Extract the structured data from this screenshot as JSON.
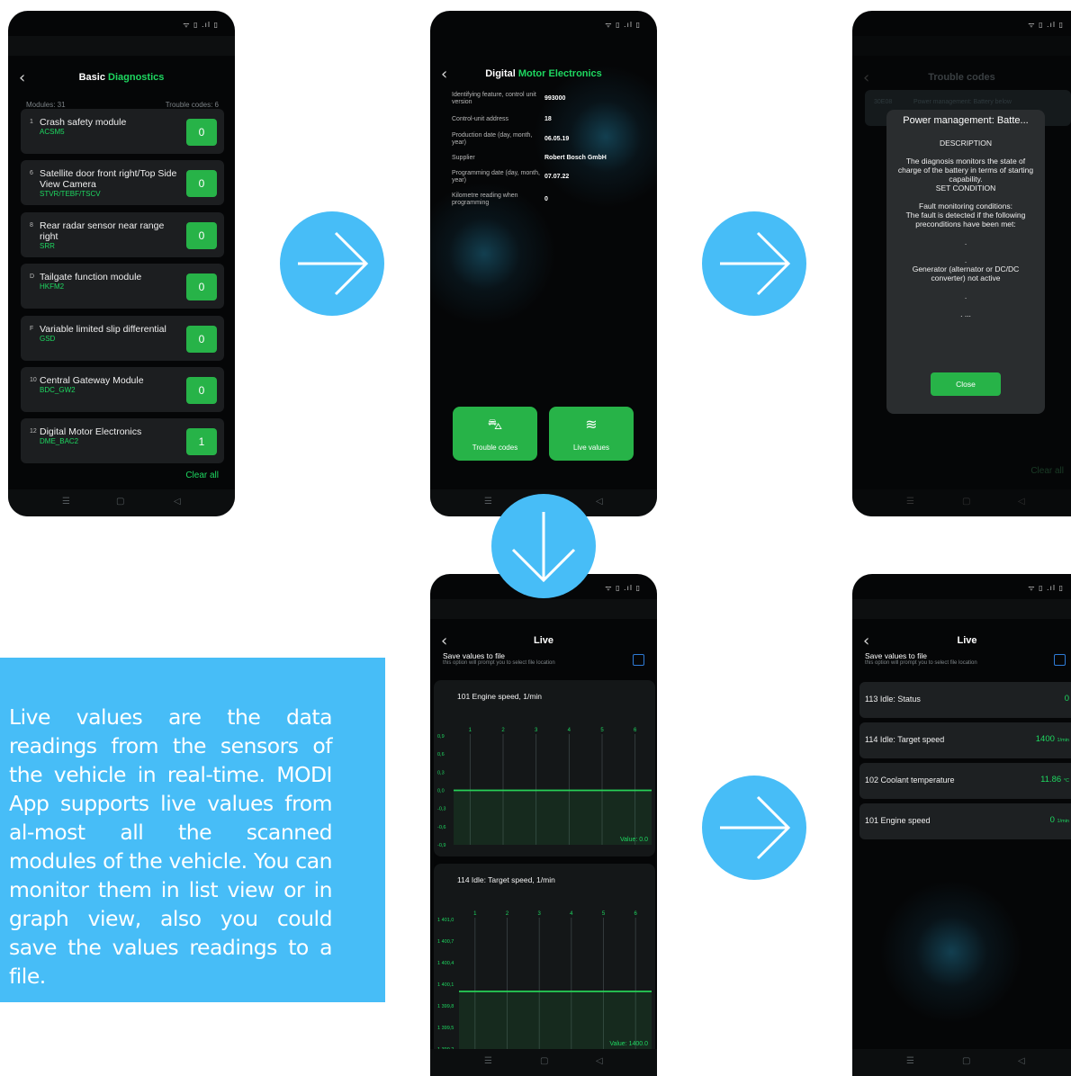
{
  "status_icons": "ᯤ ▯ .ıl ▯",
  "nav": {
    "menu": "☰",
    "home": "▢",
    "back": "◁"
  },
  "screen1": {
    "title_a": "Basic",
    "title_b": "Diagnostics",
    "modules_label": "Modules: 31",
    "trouble_label": "Trouble codes: 6",
    "modules": [
      {
        "num": "1",
        "name": "Crash safety module",
        "code": "ACSM5",
        "count": "0"
      },
      {
        "num": "6",
        "name": "Satellite door front right/Top Side View Camera",
        "code": "STVR/TEBF/TSCV",
        "count": "0"
      },
      {
        "num": "8",
        "name": "Rear radar sensor near range right",
        "code": "SRR",
        "count": "0"
      },
      {
        "num": "D",
        "name": "Tailgate function module",
        "code": "HKFM2",
        "count": "0"
      },
      {
        "num": "F",
        "name": "Variable limited slip differential",
        "code": "GSD",
        "count": "0"
      },
      {
        "num": "10",
        "name": "Central Gateway Module",
        "code": "BDC_GW2",
        "count": "0"
      },
      {
        "num": "12",
        "name": "Digital Motor Electronics",
        "code": "DME_BAC2",
        "count": "1"
      }
    ],
    "clear_all": "Clear all"
  },
  "screen2": {
    "title_a": "Digital",
    "title_b": "Motor Electronics",
    "rows": [
      {
        "k": "Identifying feature, control unit version",
        "v": "993000"
      },
      {
        "k": "Control-unit address",
        "v": "18"
      },
      {
        "k": "Production date (day, month, year)",
        "v": "06.05.19"
      },
      {
        "k": "Supplier",
        "v": "Robert Bosch GmbH"
      },
      {
        "k": "Programming date (day, month, year)",
        "v": "07.07.22"
      },
      {
        "k": "Kilometre reading when programming",
        "v": "0"
      }
    ],
    "btn_trouble": "Trouble codes",
    "btn_live": "Live values"
  },
  "screen3": {
    "title": "Trouble codes",
    "bg_code": "30E08",
    "bg_text": "Power management: Battery below",
    "dialog_title": "Power management: Batte...",
    "dialog_body": "DESCRIPTION\n\nThe diagnosis monitors the state of charge of the battery in terms of starting capability.\nSET CONDITION\n\nFault monitoring conditions:\nThe fault is detected if the following preconditions have been met:\n\n.\n\n.\nGenerator (alternator or DC/DC converter) not active\n\n.\n\n. ...",
    "close": "Close",
    "clear_all": "Clear all"
  },
  "screen4": {
    "title": "Live",
    "save_title": "Save values to file",
    "save_sub": "this option will prompt you to select file location",
    "graph1": {
      "title": "101 Engine speed, 1/min",
      "x_ticks": [
        "1",
        "2",
        "3",
        "4",
        "5",
        "6"
      ],
      "y_ticks": [
        "0,9",
        "0,6",
        "0,3",
        "0,0",
        "-0,3",
        "-0,6",
        "-0,9"
      ],
      "value_label": "Value: 0.0"
    },
    "graph2": {
      "title": "114 Idle: Target speed, 1/min",
      "x_ticks": [
        "1",
        "2",
        "3",
        "4",
        "5",
        "6"
      ],
      "y_ticks": [
        "1 401,0",
        "1 400,7",
        "1 400,4",
        "1 400,1",
        "1 399,8",
        "1 399,5",
        "1 399,2"
      ],
      "value_label": "Value: 1400.0"
    }
  },
  "chart_data": [
    {
      "type": "line",
      "title": "101 Engine speed, 1/min",
      "x": [
        1,
        2,
        3,
        4,
        5,
        6
      ],
      "series": [
        {
          "values": [
            0.0,
            0.0,
            0.0,
            0.0,
            0.0,
            0.0
          ]
        }
      ],
      "ylim": [
        -0.9,
        0.9
      ]
    },
    {
      "type": "line",
      "title": "114 Idle: Target speed, 1/min",
      "x": [
        1,
        2,
        3,
        4,
        5,
        6
      ],
      "series": [
        {
          "values": [
            1400.0,
            1400.0,
            1400.0,
            1400.0,
            1400.0,
            1400.0
          ]
        }
      ],
      "ylim": [
        1399.2,
        1401.0
      ]
    }
  ],
  "screen5": {
    "title": "Live",
    "save_title": "Save values to file",
    "save_sub": "this option will prompt you to select file location",
    "items": [
      {
        "name": "113 Idle: Status",
        "value": "0",
        "unit": ""
      },
      {
        "name": "114 Idle: Target speed",
        "value": "1400",
        "unit": "1/min"
      },
      {
        "name": "102 Coolant temperature",
        "value": "11.86",
        "unit": "°C"
      },
      {
        "name": "101 Engine speed",
        "value": "0",
        "unit": "1/min"
      }
    ]
  },
  "info_text": "Live values are the data readings from the sensors of the vehicle in real-time. MODI App supports live values from al-most all the scanned modules of the vehicle. You can monitor them in list view or in graph view, also you could save the values readings to a file.",
  "colors": {
    "accent_green": "#27b348",
    "arrow_blue": "#47bdf7",
    "screen_bg": "#050607"
  }
}
